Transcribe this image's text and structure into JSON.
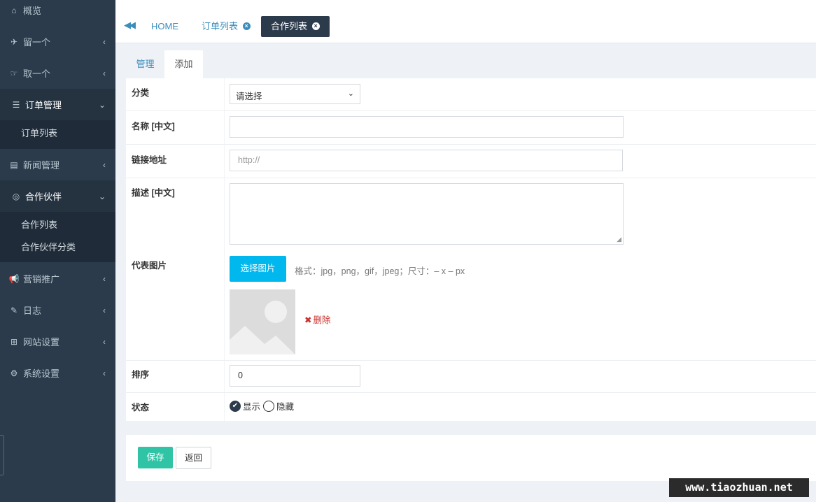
{
  "sidebar": {
    "items": [
      {
        "icon": "home-icon",
        "glyph": "⌂",
        "label": "概览"
      },
      {
        "icon": "paper-plane-icon",
        "glyph": "✈",
        "label": "留一个"
      },
      {
        "icon": "hand-icon",
        "glyph": "☞",
        "label": "取一个"
      },
      {
        "icon": "list-icon",
        "glyph": "☰",
        "label": "订单管理"
      },
      {
        "icon": "newspaper-icon",
        "glyph": "▤",
        "label": "新闻管理"
      },
      {
        "icon": "handshake-icon",
        "glyph": "◎",
        "label": "合作伙伴"
      },
      {
        "icon": "bullhorn-icon",
        "glyph": "📢",
        "label": "营销推广"
      },
      {
        "icon": "edit-icon",
        "glyph": "✎",
        "label": "日志"
      },
      {
        "icon": "sitemap-icon",
        "glyph": "⊞",
        "label": "网站设置"
      },
      {
        "icon": "gear-icon",
        "glyph": "⚙",
        "label": "系统设置"
      }
    ],
    "order_sub": [
      "订单列表"
    ],
    "partner_sub": [
      "合作列表",
      "合作伙伴分类"
    ]
  },
  "tabbar": {
    "back_glyph": "◀◀",
    "tabs": [
      {
        "label": "HOME",
        "closable": false
      },
      {
        "label": "订单列表",
        "closable": true
      },
      {
        "label": "合作列表",
        "closable": true
      }
    ],
    "close_glyph": "×"
  },
  "subtabs": {
    "manage": "管理",
    "add": "添加"
  },
  "form": {
    "category_label": "分类",
    "category_value": "请选择",
    "name_label": "名称 [中文]",
    "name_value": "",
    "link_label": "链接地址",
    "link_placeholder": "http://",
    "desc_label": "描述 [中文]",
    "image_label": "代表图片",
    "pick_button": "选择图片",
    "format_hint": "格式：jpg，png，gif，jpeg；尺寸：– x – px",
    "delete_label": "删除",
    "sort_label": "排序",
    "sort_value": "0",
    "status_label": "状态",
    "status_show": "显示",
    "status_hide": "隐藏"
  },
  "footer": {
    "save": "保存",
    "back": "返回"
  },
  "watermark": "www.tiaozhuan.net",
  "colors": {
    "sidebar": "#2c3b4c",
    "accent": "#3c8dbc",
    "pick": "#00b7ee",
    "save": "#2ec4a5",
    "danger": "#c9302c"
  }
}
